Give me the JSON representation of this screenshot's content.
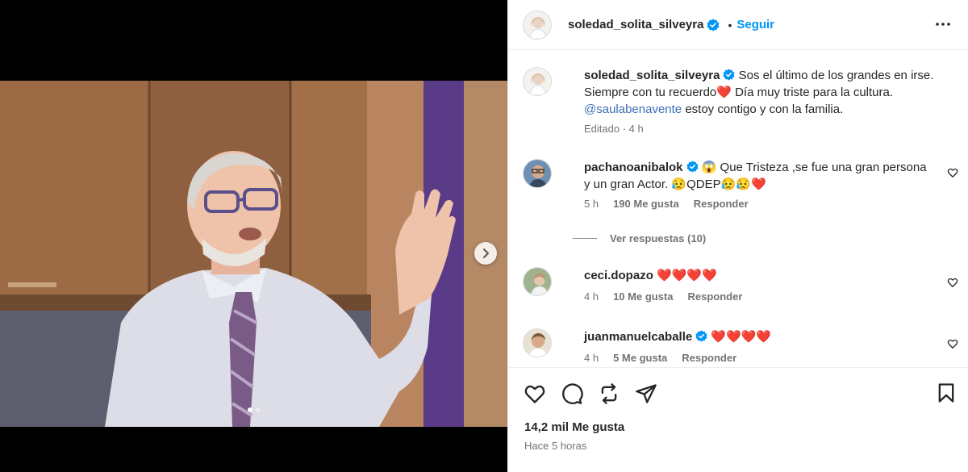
{
  "post": {
    "author": "soledad_solita_silveyra",
    "follow_label": "Seguir",
    "separator": "•",
    "caption_text": "Sos el último de los grandes en irse. Siempre con tu recuerdo❤️ Día muy triste para la cultura. ",
    "caption_mention": "@saulabenavente",
    "caption_tail": " estoy contigo y con la familia.",
    "caption_meta": "Editado · 4 h",
    "likes": "14,2 mil Me gusta",
    "posted": "Hace 5 horas"
  },
  "comments": [
    {
      "user": "pachanoanibalok",
      "text": " 😱 Que Tristeza ,se fue una gran persona y un gran Actor. 😥QDEP😥😥❤️",
      "time": "5 h",
      "likes": "190 Me gusta",
      "reply": "Responder",
      "view_replies": "Ver respuestas (10)"
    },
    {
      "user": "ceci.dopazo",
      "text": " ❤️❤️❤️❤️",
      "time": "4 h",
      "likes": "10 Me gusta",
      "reply": "Responder"
    },
    {
      "user": "juanmanuelcaballe",
      "text": " ❤️❤️❤️❤️",
      "time": "4 h",
      "likes": "5 Me gusta",
      "reply": "Responder"
    }
  ],
  "carousel": {
    "count": 2,
    "current": 1
  },
  "colors": {
    "link": "#0095f6",
    "verified": "#0095f6",
    "mention": "#3b6fb6"
  },
  "icons": [
    "heart-icon",
    "comment-icon",
    "repost-icon",
    "share-icon",
    "bookmark-icon",
    "more-icon",
    "chevron-right-icon"
  ]
}
